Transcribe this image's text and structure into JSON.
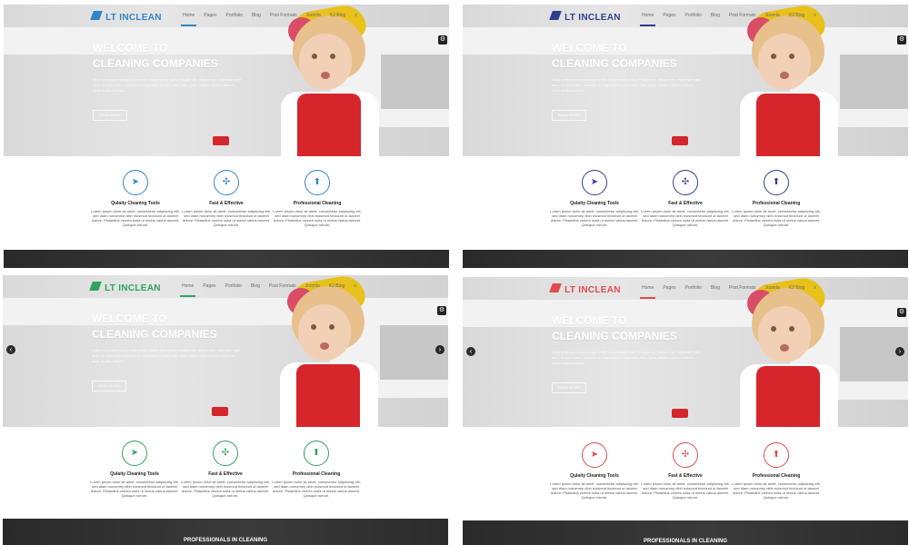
{
  "panels": [
    {
      "id": "p1",
      "accent": "#2f86c8",
      "logo": {
        "lt": "LT",
        "name": "INCLEAN"
      },
      "nav": [
        "Home",
        "Pages",
        "Portfolio",
        "Blog",
        "Post Formats",
        "Joomla",
        "K2 Blog",
        ""
      ],
      "active_nav_index": 0,
      "hero": {
        "title_line1": "WELCOME TO",
        "title_line2": "CLEANING COMPANIES",
        "subtitle": "Nulla consequat massa quis enim. Donec pede justo, fringilla vel, aliquet nec, vulputate eget, arcu. In enim justo, rhoncus ut, imperdiet a, venenatis vitae, justo. Nullam dictum felis eu pede mollis pretium.",
        "button": "READ MORE"
      },
      "features": [
        {
          "icon": "paper-plane-icon",
          "glyph": "➤",
          "title": "Qulaity Cleaning Tools",
          "desc": "Lorem ipsum dolor sit amet, consectetur adipiscing elit, sed diam nonummy nibh euismod tincidunt ut laoreet dolore. Phasellus viverra nulla ut metus varius laoreet. Quisque rutrum."
        },
        {
          "icon": "broom-icon",
          "glyph": "✣",
          "title": "Fast & Effective",
          "desc": "Lorem ipsum dolor sit amet, consectetur adipiscing elit, sed diam nonummy nibh euismod tincidunt ut laoreet dolore. Phasellus viverra nulla ut metus varius laoreet. Quisque rutrum."
        },
        {
          "icon": "spray-bottle-icon",
          "glyph": "⬆",
          "title": "Professional Cleaning",
          "desc": "Lorem ipsum dolor sit amet, consectetur adipiscing elit, sed diam nonummy nibh euismod tincidunt ut laoreet dolore. Phasellus viverra nulla ut metus varius laoreet. Quisque rutrum."
        }
      ],
      "show_arrows": false,
      "dark_title": ""
    },
    {
      "id": "p2",
      "accent": "#2e3f8f",
      "logo": {
        "lt": "LT",
        "name": "INCLEAN"
      },
      "nav": [
        "Home",
        "Pages",
        "Portfolio",
        "Blog",
        "Post Formats",
        "Joomla",
        "K2 Blog",
        ""
      ],
      "active_nav_index": 0,
      "hero": {
        "title_line1": "WELCOME TO",
        "title_line2": "CLEANING COMPANIES",
        "subtitle": "Nulla consequat massa quis enim. Donec pede justo, fringilla vel, aliquet nec, vulputate eget, arcu. In enim justo, rhoncus ut, imperdiet a, venenatis vitae, justo. Nullam dictum felis eu pede mollis pretium.",
        "button": "READ MORE"
      },
      "features": [
        {
          "icon": "paper-plane-icon",
          "glyph": "➤",
          "title": "Qulaity Cleaning Tools",
          "desc": "Lorem ipsum dolor sit amet, consectetur adipiscing elit, sed diam nonummy nibh euismod tincidunt ut laoreet dolore. Phasellus viverra nulla ut metus varius laoreet. Quisque rutrum."
        },
        {
          "icon": "broom-icon",
          "glyph": "✣",
          "title": "Fast & Effective",
          "desc": "Lorem ipsum dolor sit amet, consectetur adipiscing elit, sed diam nonummy nibh euismod tincidunt ut laoreet dolore. Phasellus viverra nulla ut metus varius laoreet. Quisque rutrum."
        },
        {
          "icon": "spray-bottle-icon",
          "glyph": "⬆",
          "title": "Professional Cleaning",
          "desc": "Lorem ipsum dolor sit amet, consectetur adipiscing elit, sed diam nonummy nibh euismod tincidunt ut laoreet dolore. Phasellus viverra nulla ut metus varius laoreet. Quisque rutrum."
        }
      ],
      "show_arrows": false,
      "dark_title": ""
    },
    {
      "id": "p3",
      "accent": "#2fa25f",
      "logo": {
        "lt": "LT",
        "name": "INCLEAN"
      },
      "nav": [
        "Home",
        "Pages",
        "Portfolio",
        "Blog",
        "Post Formats",
        "Joomla",
        "K2 Blog",
        ""
      ],
      "active_nav_index": 0,
      "hero": {
        "title_line1": "WELCOME TO",
        "title_line2": "CLEANING COMPANIES",
        "subtitle": "Nulla consequat massa quis enim. Donec pede justo, fringilla vel, aliquet nec, vulputate eget, arcu. In enim justo, rhoncus ut, imperdiet a, venenatis vitae, justo. Nullam dictum felis eu pede mollis pretium.",
        "button": "READ MORE"
      },
      "features": [
        {
          "icon": "paper-plane-icon",
          "glyph": "➤",
          "title": "Qulaity Cleaning Tools",
          "desc": "Lorem ipsum dolor sit amet, consectetur adipiscing elit, sed diam nonummy nibh euismod tincidunt ut laoreet dolore. Phasellus viverra nulla ut metus varius laoreet. Quisque rutrum."
        },
        {
          "icon": "broom-icon",
          "glyph": "✣",
          "title": "Fast & Effective",
          "desc": "Lorem ipsum dolor sit amet, consectetur adipiscing elit, sed diam nonummy nibh euismod tincidunt ut laoreet dolore. Phasellus viverra nulla ut metus varius laoreet. Quisque rutrum."
        },
        {
          "icon": "spray-bottle-icon",
          "glyph": "⬆",
          "title": "Professional Cleaning",
          "desc": "Lorem ipsum dolor sit amet, consectetur adipiscing elit, sed diam nonummy nibh euismod tincidunt ut laoreet dolore. Phasellus viverra nulla ut metus varius laoreet. Quisque rutrum."
        }
      ],
      "show_arrows": true,
      "dark_title": "PROFESSIONALS IN CLEANING"
    },
    {
      "id": "p4",
      "accent": "#e04b4b",
      "logo": {
        "lt": "LT",
        "name": "INCLEAN"
      },
      "nav": [
        "Home",
        "Pages",
        "Portfolio",
        "Blog",
        "Post Formats",
        "Joomla",
        "K2 Blog",
        ""
      ],
      "active_nav_index": 0,
      "hero": {
        "title_line1": "WELCOME TO",
        "title_line2": "CLEANING COMPANIES",
        "subtitle": "Nulla consequat massa quis enim. Donec pede justo, fringilla vel, aliquet nec, vulputate eget, arcu. In enim justo, rhoncus ut, imperdiet a, venenatis vitae, justo. Nullam dictum felis eu pede mollis pretium.",
        "button": "READ MORE"
      },
      "features": [
        {
          "icon": "paper-plane-icon",
          "glyph": "➤",
          "title": "Qulaity Cleaning Tools",
          "desc": "Lorem ipsum dolor sit amet, consectetur adipiscing elit, sed diam nonummy nibh euismod tincidunt ut laoreet dolore. Phasellus viverra nulla ut metus varius laoreet. Quisque rutrum."
        },
        {
          "icon": "broom-icon",
          "glyph": "✣",
          "title": "Fast & Effective",
          "desc": "Lorem ipsum dolor sit amet, consectetur adipiscing elit, sed diam nonummy nibh euismod tincidunt ut laoreet dolore. Phasellus viverra nulla ut metus varius laoreet. Quisque rutrum."
        },
        {
          "icon": "spray-bottle-icon",
          "glyph": "⬆",
          "title": "Professional Cleaning",
          "desc": "Lorem ipsum dolor sit amet, consectetur adipiscing elit, sed diam nonummy nibh euismod tincidunt ut laoreet dolore. Phasellus viverra nulla ut metus varius laoreet. Quisque rutrum."
        }
      ],
      "show_arrows": true,
      "dark_title": "PROFESSIONALS IN CLEANING"
    }
  ]
}
